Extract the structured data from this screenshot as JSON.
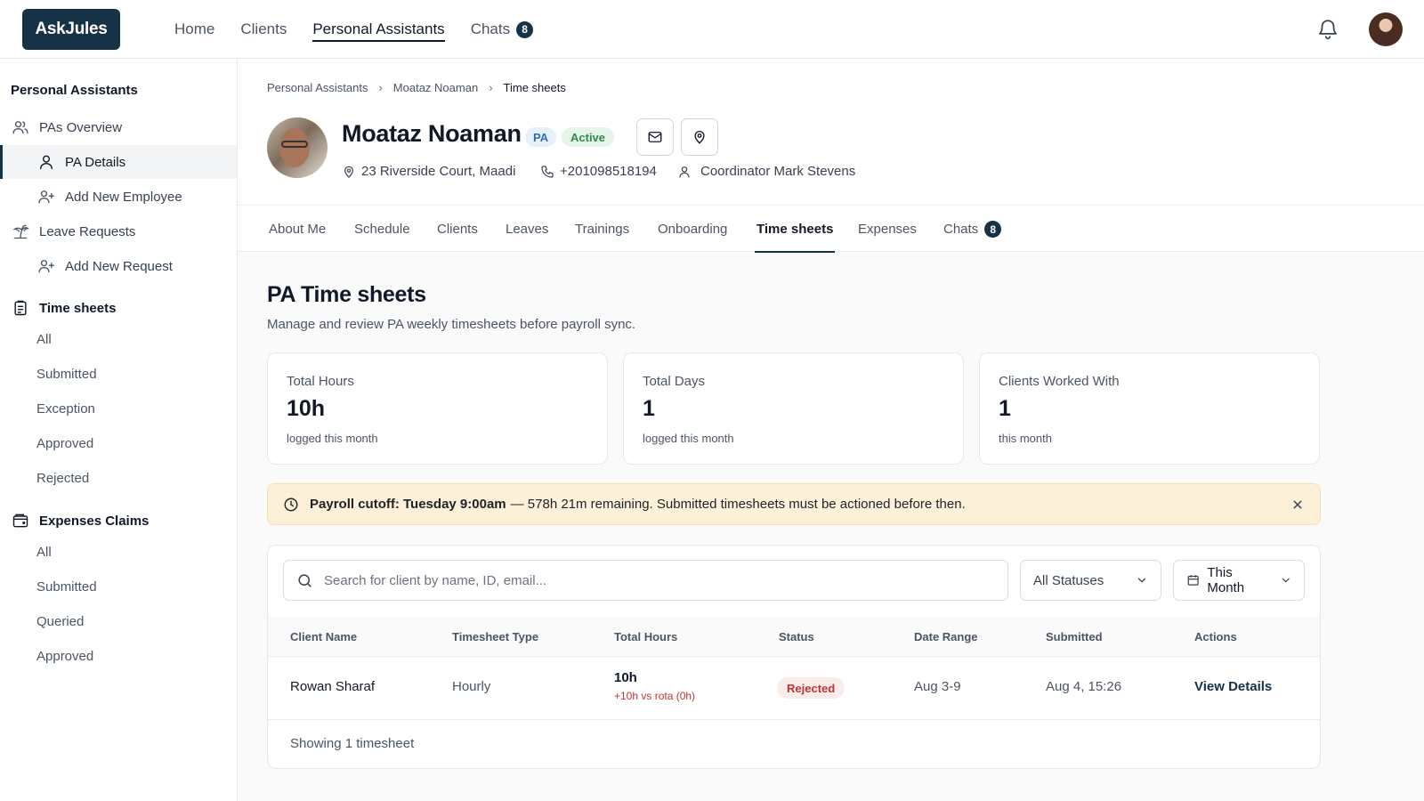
{
  "brand": {
    "logo": "AskJules"
  },
  "topnav": {
    "items": [
      {
        "label": "Home"
      },
      {
        "label": "Clients"
      },
      {
        "label": "Personal Assistants"
      },
      {
        "label": "Chats",
        "badge": "8"
      }
    ],
    "active": "Personal Assistants"
  },
  "sidebar": {
    "title": "Personal Assistants",
    "pas_overview": "PAs Overview",
    "pa_details": "PA Details",
    "add_employee": "Add New Employee",
    "leave_requests": "Leave Requests",
    "add_request": "Add New Request",
    "timesheets": {
      "title": "Time sheets",
      "items": [
        "All",
        "Submitted",
        "Exception",
        "Approved",
        "Rejected"
      ]
    },
    "expenses": {
      "title": "Expenses Claims",
      "items": [
        "All",
        "Submitted",
        "Queried",
        "Approved"
      ]
    }
  },
  "breadcrumb": [
    "Personal Assistants",
    "Moataz Noaman",
    "Time sheets"
  ],
  "profile": {
    "name": "Moataz Noaman",
    "role_badge": "PA",
    "status_badge": "Active",
    "address": "23 Riverside Court, Maadi",
    "phone": "+201098518194",
    "coordinator": "Coordinator Mark Stevens"
  },
  "tabs": {
    "items": [
      "About Me",
      "Schedule",
      "Clients",
      "Leaves",
      "Trainings",
      "Onboarding",
      "Time sheets",
      "Expenses",
      "Chats"
    ],
    "chats_badge": "8",
    "active": "Time sheets"
  },
  "page": {
    "title": "PA Time sheets",
    "subtitle": "Manage and review PA weekly timesheets before payroll sync."
  },
  "stats": [
    {
      "label": "Total Hours",
      "value": "10h",
      "note": "logged this month"
    },
    {
      "label": "Total Days",
      "value": "1",
      "note": "logged this month"
    },
    {
      "label": "Clients Worked With",
      "value": "1",
      "note": "this month"
    }
  ],
  "alert": {
    "bold": "Payroll cutoff: Tuesday 9:00am",
    "text": "— 578h 21m remaining. Submitted timesheets must be actioned before then.",
    "bg_color": "#fdf0d8"
  },
  "filters": {
    "search_placeholder": "Search for client by name, ID, email...",
    "status_select": "All Statuses",
    "date_select": "This Month"
  },
  "table": {
    "columns": [
      "Client Name",
      "Timesheet Type",
      "Total Hours",
      "Status",
      "Date Range",
      "Submitted",
      "Actions"
    ],
    "rows": [
      {
        "client": "Rowan Sharaf",
        "type": "Hourly",
        "hours": "10h",
        "hours_note": "+10h vs rota (0h)",
        "status": "Rejected",
        "date_range": "Aug 3-9",
        "submitted": "Aug 4, 15:26",
        "action": "View Details"
      }
    ],
    "footer": "Showing 1 timesheet"
  },
  "colors": {
    "brand": "#163247",
    "rejected": "#c0342f",
    "active_green": "#2f8a4a",
    "pa_blue": "#2f6db3"
  }
}
